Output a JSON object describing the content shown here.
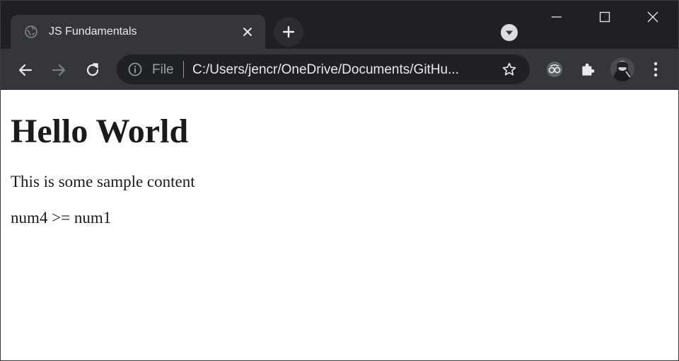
{
  "browser": {
    "tab": {
      "title": "JS Fundamentals"
    },
    "address_bar": {
      "scheme_label": "File",
      "url": "C:/Users/jencr/OneDrive/Documents/GitHu..."
    },
    "icons": {
      "favicon": "globe-icon",
      "tab_close": "close-icon",
      "new_tab": "plus-icon",
      "tab_search": "chevron-down-icon",
      "back": "arrow-left-icon",
      "forward": "arrow-right-icon",
      "reload": "reload-icon",
      "site_info": "info-icon",
      "bookmark": "star-icon",
      "extension_1": "reader-extension-icon",
      "extensions": "puzzle-icon",
      "profile": "avatar",
      "menu": "kebab-menu-icon"
    },
    "colors": {
      "tabstrip_bg": "#1f2023",
      "toolbar_bg": "#35363a",
      "omnibox_bg": "#202124",
      "text_light": "#e8eaed",
      "text_muted": "#9aa0a6"
    }
  },
  "page": {
    "heading": "Hello World",
    "paragraphs": [
      "This is some sample content",
      "num4 >= num1"
    ]
  }
}
